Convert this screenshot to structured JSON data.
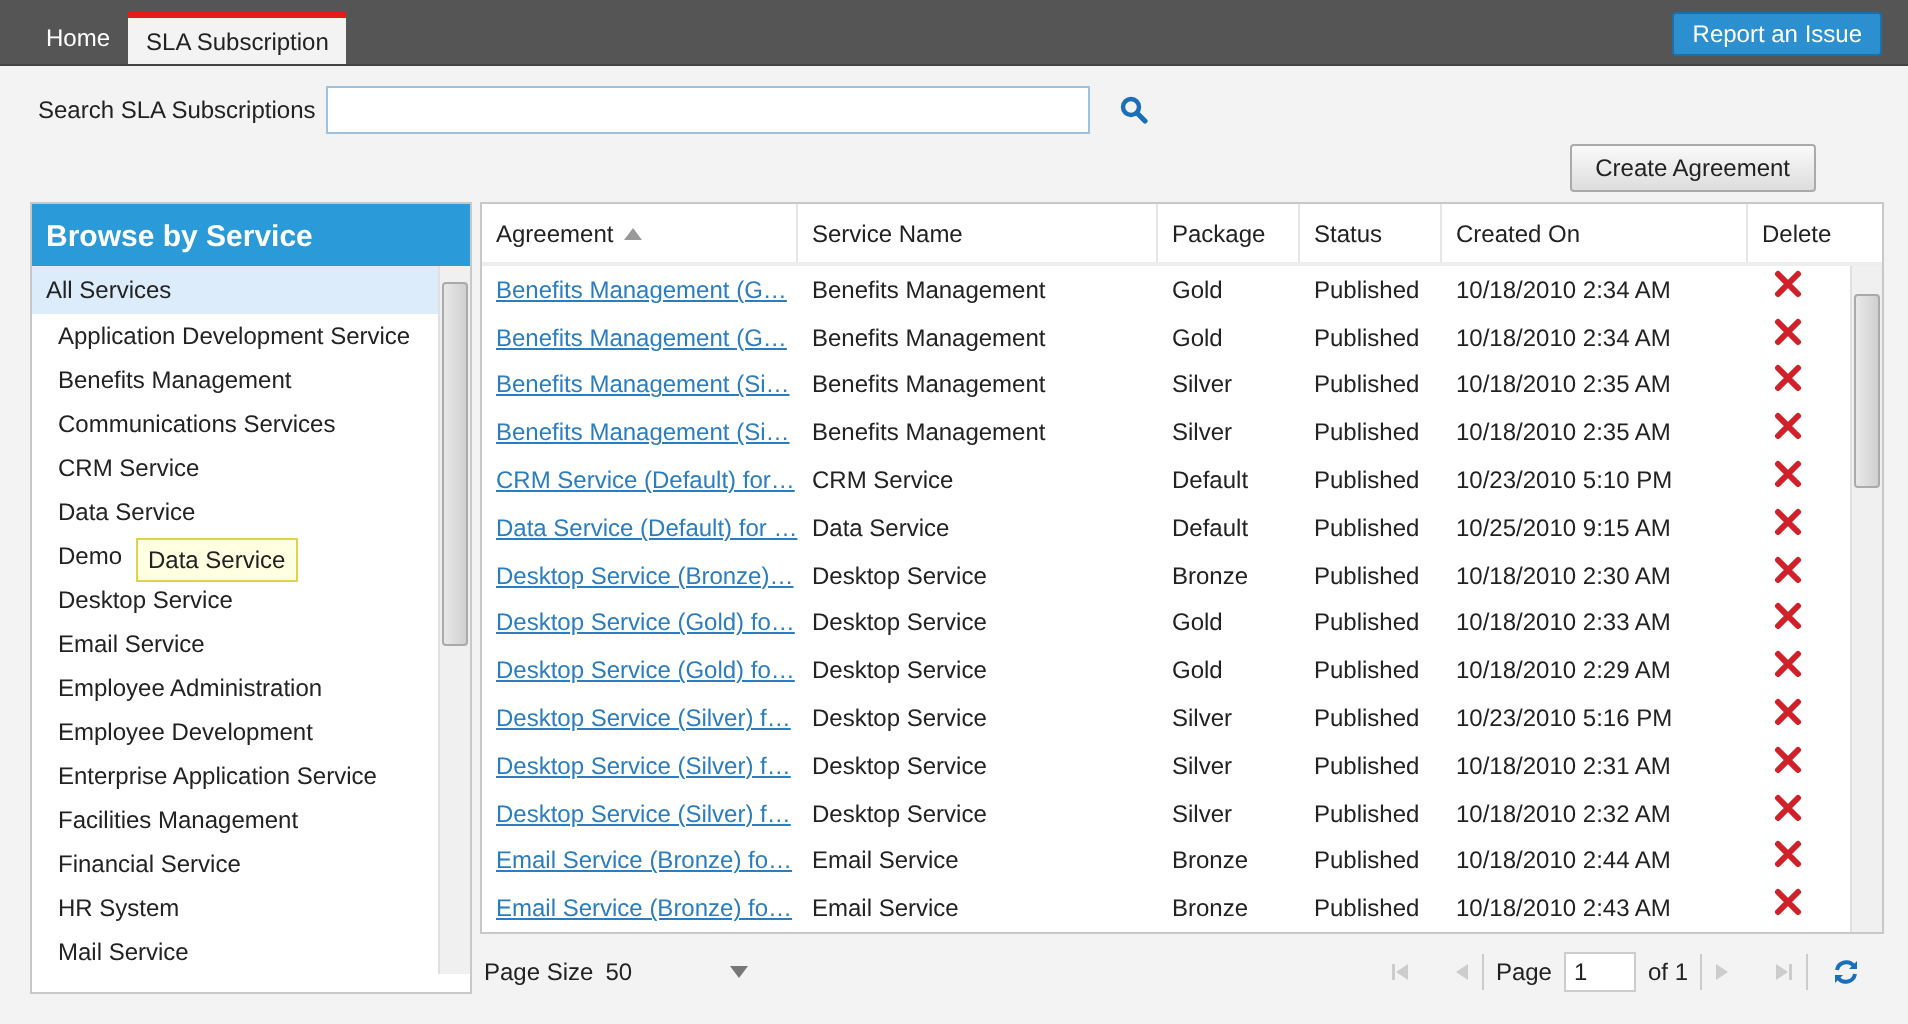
{
  "tabs": [
    {
      "label": "Home",
      "selected": false
    },
    {
      "label": "SLA Subscription",
      "selected": true
    }
  ],
  "report_button": "Report an Issue",
  "search": {
    "label": "Search SLA Subscriptions"
  },
  "create_button": "Create Agreement",
  "sidebar": {
    "title": "Browse by Service",
    "tooltip": "Data Service",
    "items": [
      {
        "label": "All Services",
        "selected": true
      },
      {
        "label": "Application Development Service",
        "selected": false
      },
      {
        "label": "Benefits Management",
        "selected": false
      },
      {
        "label": "Communications Services",
        "selected": false
      },
      {
        "label": "CRM Service",
        "selected": false
      },
      {
        "label": "Data Service",
        "selected": false
      },
      {
        "label": "Demo",
        "selected": false
      },
      {
        "label": "Desktop Service",
        "selected": false
      },
      {
        "label": "Email Service",
        "selected": false
      },
      {
        "label": "Employee Administration",
        "selected": false
      },
      {
        "label": "Employee Development",
        "selected": false
      },
      {
        "label": "Enterprise Application Service",
        "selected": false
      },
      {
        "label": "Facilities Management",
        "selected": false
      },
      {
        "label": "Financial Service",
        "selected": false
      },
      {
        "label": "HR System",
        "selected": false
      },
      {
        "label": "Mail Service",
        "selected": false
      }
    ]
  },
  "table": {
    "columns": [
      "Agreement",
      "Service Name",
      "Package",
      "Status",
      "Created On",
      "Delete"
    ],
    "rows": [
      {
        "agreement": "Benefits Management (G…",
        "service": "Benefits Management",
        "package": "Gold",
        "status": "Published",
        "created": "10/18/2010 2:34 AM"
      },
      {
        "agreement": "Benefits Management (G…",
        "service": "Benefits Management",
        "package": "Gold",
        "status": "Published",
        "created": "10/18/2010 2:34 AM"
      },
      {
        "agreement": "Benefits Management (Si…",
        "service": "Benefits Management",
        "package": "Silver",
        "status": "Published",
        "created": "10/18/2010 2:35 AM"
      },
      {
        "agreement": "Benefits Management (Si…",
        "service": "Benefits Management",
        "package": "Silver",
        "status": "Published",
        "created": "10/18/2010 2:35 AM"
      },
      {
        "agreement": "CRM Service (Default) for…",
        "service": "CRM Service",
        "package": "Default",
        "status": "Published",
        "created": "10/23/2010 5:10 PM"
      },
      {
        "agreement": "Data Service (Default) for …",
        "service": "Data Service",
        "package": "Default",
        "status": "Published",
        "created": "10/25/2010 9:15 AM"
      },
      {
        "agreement": "Desktop Service (Bronze)…",
        "service": "Desktop Service",
        "package": "Bronze",
        "status": "Published",
        "created": "10/18/2010 2:30 AM"
      },
      {
        "agreement": "Desktop Service (Gold) fo…",
        "service": "Desktop Service",
        "package": "Gold",
        "status": "Published",
        "created": "10/18/2010 2:33 AM"
      },
      {
        "agreement": "Desktop Service (Gold) fo…",
        "service": "Desktop Service",
        "package": "Gold",
        "status": "Published",
        "created": "10/18/2010 2:29 AM"
      },
      {
        "agreement": "Desktop Service (Silver) f…",
        "service": "Desktop Service",
        "package": "Silver",
        "status": "Published",
        "created": "10/23/2010 5:16 PM"
      },
      {
        "agreement": "Desktop Service (Silver) f…",
        "service": "Desktop Service",
        "package": "Silver",
        "status": "Published",
        "created": "10/18/2010 2:31 AM"
      },
      {
        "agreement": "Desktop Service (Silver) f…",
        "service": "Desktop Service",
        "package": "Silver",
        "status": "Published",
        "created": "10/18/2010 2:32 AM"
      },
      {
        "agreement": "Email Service (Bronze) fo…",
        "service": "Email Service",
        "package": "Bronze",
        "status": "Published",
        "created": "10/18/2010 2:44 AM"
      },
      {
        "agreement": "Email Service (Bronze) fo…",
        "service": "Email Service",
        "package": "Bronze",
        "status": "Published",
        "created": "10/18/2010 2:43 AM"
      }
    ]
  },
  "pager": {
    "page_size_label": "Page Size",
    "page_size": "50",
    "page_label": "Page",
    "page": "1",
    "of_label": "of 1"
  }
}
